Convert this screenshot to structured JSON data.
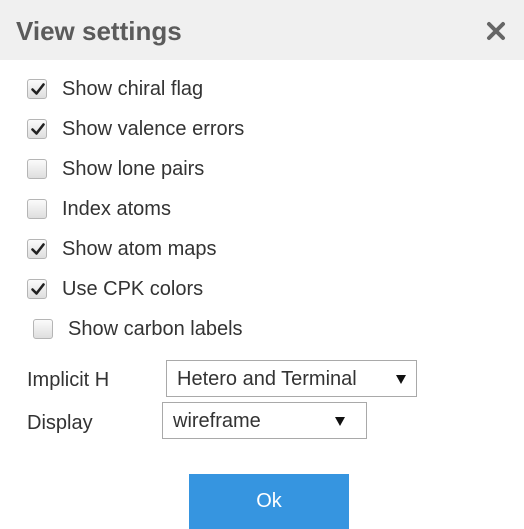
{
  "dialog": {
    "title": "View settings",
    "close_icon": "close-icon"
  },
  "options": [
    {
      "label": "Show chiral flag",
      "checked": true
    },
    {
      "label": "Show valence errors",
      "checked": true
    },
    {
      "label": "Show lone pairs",
      "checked": false
    },
    {
      "label": "Index atoms",
      "checked": false
    },
    {
      "label": "Show atom maps",
      "checked": true
    },
    {
      "label": "Use CPK colors",
      "checked": true
    },
    {
      "label": "Show carbon labels",
      "checked": false
    }
  ],
  "implicit_h": {
    "label": "Implicit H",
    "value": "Hetero and Terminal"
  },
  "display": {
    "label": "Display",
    "value": "wireframe"
  },
  "ok_label": "Ok",
  "colors": {
    "header_bg": "#f0f0f0",
    "title_text": "#5b5b5b",
    "ok_button": "#3695e0"
  }
}
